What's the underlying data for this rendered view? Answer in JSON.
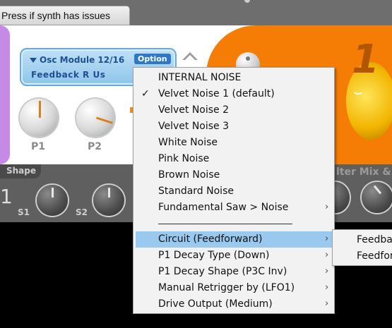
{
  "window": {
    "tab_label": "Press if synth has issues"
  },
  "module": {
    "title": "Osc Module 12/16",
    "name": "Feedback R Us",
    "option_label": "Option"
  },
  "knobs": [
    {
      "label": "P1"
    },
    {
      "label": "P2"
    }
  ],
  "strip": {
    "shape_label": "Shape",
    "side_digit": "1",
    "knob_labels": [
      "S1",
      "S2"
    ],
    "filter_mix_label": "lter Mix &"
  },
  "big_digit": "1",
  "context_menu": {
    "items": [
      {
        "label": "INTERNAL NOISE",
        "checked": false,
        "submenu": false,
        "highlighted": false
      },
      {
        "label": "Velvet Noise 1 (default)",
        "checked": true,
        "submenu": false,
        "highlighted": false
      },
      {
        "label": "Velvet Noise 2",
        "checked": false,
        "submenu": false,
        "highlighted": false
      },
      {
        "label": "Velvet Noise 3",
        "checked": false,
        "submenu": false,
        "highlighted": false
      },
      {
        "label": "White Noise",
        "checked": false,
        "submenu": false,
        "highlighted": false
      },
      {
        "label": "Pink Noise",
        "checked": false,
        "submenu": false,
        "highlighted": false
      },
      {
        "label": "Brown Noise",
        "checked": false,
        "submenu": false,
        "highlighted": false
      },
      {
        "label": "Standard Noise",
        "checked": false,
        "submenu": false,
        "highlighted": false
      },
      {
        "label": "Fundamental Saw > Noise",
        "checked": false,
        "submenu": true,
        "highlighted": false
      },
      {
        "label": "Circuit (Feedforward)",
        "checked": false,
        "submenu": true,
        "highlighted": true
      },
      {
        "label": "P1 Decay Type (Down)",
        "checked": false,
        "submenu": true,
        "highlighted": false
      },
      {
        "label": "P1 Decay Shape (P3C Inv)",
        "checked": false,
        "submenu": true,
        "highlighted": false
      },
      {
        "label": "Manual Retrigger by (LFO1)",
        "checked": false,
        "submenu": true,
        "highlighted": false
      },
      {
        "label": "Drive Output (Medium)",
        "checked": false,
        "submenu": true,
        "highlighted": false
      }
    ],
    "check_glyph": "✓",
    "arrow_glyph": "›"
  },
  "submenu": {
    "items": [
      "Feedba",
      "Feedfor"
    ]
  },
  "colors": {
    "menu_highlight": "#99c9ef",
    "panel_orange": "#f57d05",
    "module_blue": "#8ec5ea"
  }
}
